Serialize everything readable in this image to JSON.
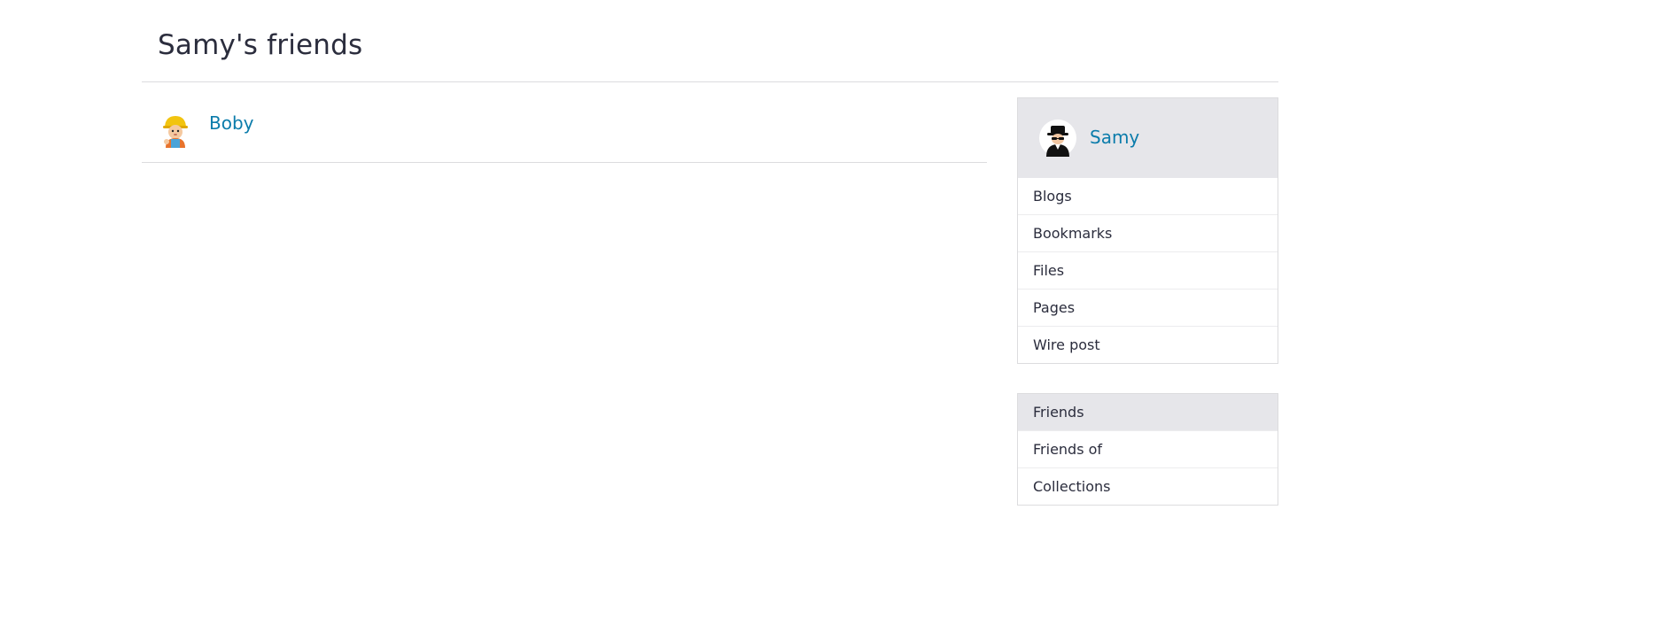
{
  "page": {
    "title": "Samy's friends"
  },
  "friends": [
    {
      "name": "Boby",
      "avatar_icon": "builder-avatar-icon"
    }
  ],
  "owner": {
    "name": "Samy",
    "avatar_icon": "spy-avatar-icon"
  },
  "owner_menu": [
    {
      "label": "Blogs"
    },
    {
      "label": "Bookmarks"
    },
    {
      "label": "Files"
    },
    {
      "label": "Pages"
    },
    {
      "label": "Wire post"
    }
  ],
  "filter_menu": [
    {
      "label": "Friends",
      "selected": true
    },
    {
      "label": "Friends of",
      "selected": false
    },
    {
      "label": "Collections",
      "selected": false
    }
  ],
  "colors": {
    "link": "#0b7cab",
    "text": "#2b2d3d",
    "panel_header": "#e6e6ea",
    "border": "#dcdcde"
  }
}
